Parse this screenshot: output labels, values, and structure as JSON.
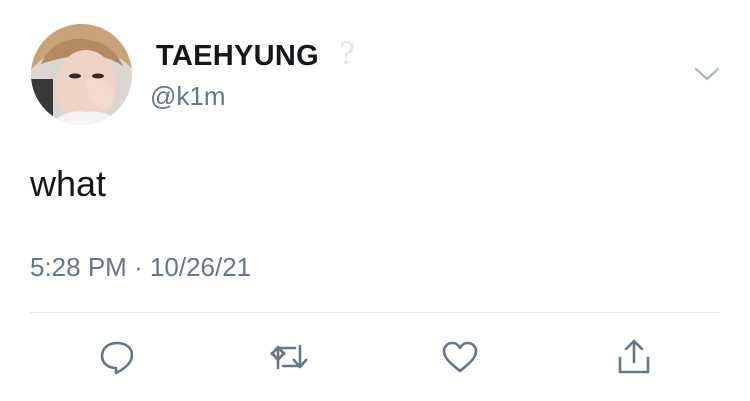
{
  "header": {
    "display_name": "TAEHYUNG",
    "badge_glyph": "?",
    "handle": "@k1m"
  },
  "tweet": {
    "text": "what",
    "timestamp": "5:28 PM · 10/26/21"
  },
  "actions": [
    {
      "name": "reply",
      "icon": "reply-icon"
    },
    {
      "name": "retweet",
      "icon": "retweet-icon"
    },
    {
      "name": "like",
      "icon": "heart-icon"
    },
    {
      "name": "share",
      "icon": "share-icon"
    }
  ],
  "colors": {
    "text": "#14171a",
    "secondary": "#657786",
    "divider": "#e1e8ed",
    "icon": "#657786"
  }
}
